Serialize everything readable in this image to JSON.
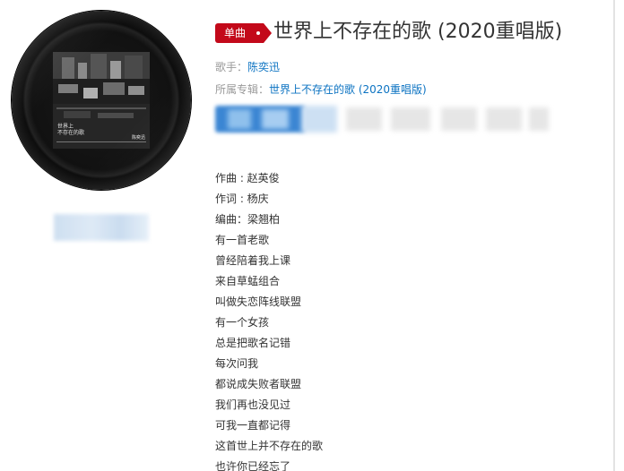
{
  "song": {
    "tag": "单曲",
    "title": "世界上不存在的歌 (2020重唱版)",
    "artist_label": "歌手：",
    "artist": "陈奕迅",
    "album_label": "所属专辑：",
    "album": "世界上不存在的歌 (2020重唱版)"
  },
  "cover": {
    "caption_line1": "世界上",
    "caption_line2": "不存在的歌",
    "artist_mark": "陈奕迅"
  },
  "colors": {
    "accent_red": "#c3091a",
    "link_blue": "#0c73c2",
    "label_gray": "#999999",
    "text": "#333333"
  },
  "lyrics": [
    "作曲 : 赵英俊",
    "作词 : 杨庆",
    "编曲：梁翘柏",
    "有一首老歌",
    "曾经陪着我上课",
    "来自草蜢组合",
    "叫做失恋阵线联盟",
    "有一个女孩",
    "总是把歌名记错",
    "每次问我",
    "都说成失败者联盟",
    "我们再也没见过",
    "可我一直都记得",
    "这首世上并不存在的歌",
    "也许你已经忘了"
  ]
}
